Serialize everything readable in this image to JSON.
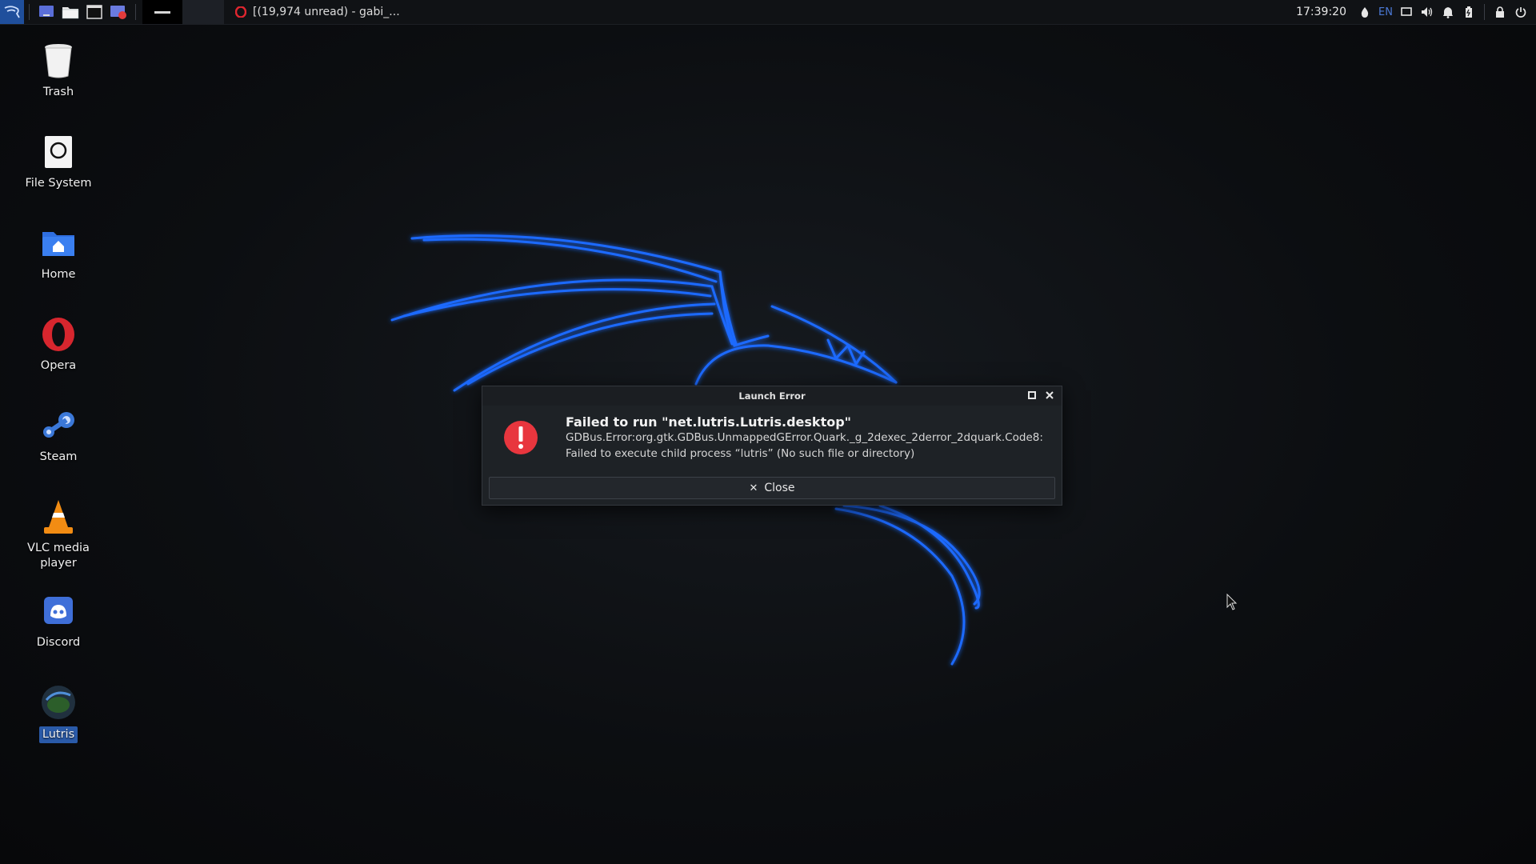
{
  "panel": {
    "task_title": "[(19,974 unread) - gabi_...",
    "clock": "17:39:20",
    "language": "EN"
  },
  "desktop": {
    "icons": [
      {
        "label": "Trash"
      },
      {
        "label": "File System"
      },
      {
        "label": "Home"
      },
      {
        "label": "Opera"
      },
      {
        "label": "Steam"
      },
      {
        "label": "VLC media player"
      },
      {
        "label": "Discord"
      },
      {
        "label": "Lutris"
      }
    ]
  },
  "dialog": {
    "title": "Launch Error",
    "heading": "Failed to run \"net.lutris.Lutris.desktop\"",
    "message_line1": "GDBus.Error:org.gtk.GDBus.UnmappedGError.Quark._g_2dexec_2derror_2dquark.Code8:",
    "message_line2": "Failed to execute child process “lutris” (No such file or directory)",
    "close_label": "Close",
    "close_glyph": "✕"
  },
  "colors": {
    "accent_blue": "#1f6bff",
    "error_red": "#e8363e",
    "selection": "#2a5aa8"
  }
}
